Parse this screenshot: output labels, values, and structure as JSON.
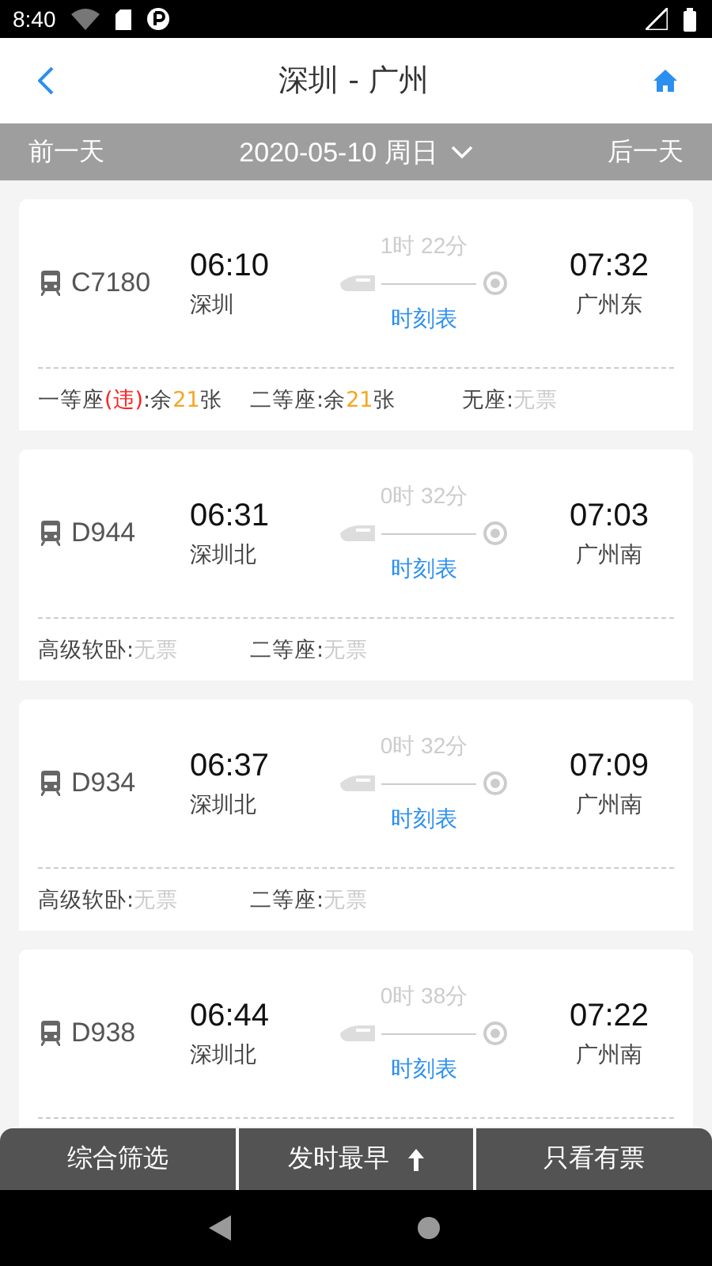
{
  "status_bar": {
    "time": "8:40"
  },
  "header": {
    "title": "深圳 - 广州"
  },
  "date_bar": {
    "prev": "前一天",
    "date": "2020-05-10 周日",
    "next": "后一天"
  },
  "trains": [
    {
      "number": "C7180",
      "depart_time": "06:10",
      "depart_station": "深圳",
      "duration": "1时 22分",
      "schedule_link": "时刻表",
      "arrive_time": "07:32",
      "arrive_station": "广州东",
      "seats": [
        [
          {
            "text": "一等座",
            "color": "#444444"
          },
          {
            "text": "(违)",
            "color": "#ff2222"
          },
          {
            "text": ":余",
            "color": "#444444"
          },
          {
            "text": "21",
            "color": "#f5a623"
          },
          {
            "text": "张",
            "color": "#444444"
          }
        ],
        [
          {
            "text": "二等座:余",
            "color": "#444444"
          },
          {
            "text": "21",
            "color": "#f5a623"
          },
          {
            "text": "张",
            "color": "#444444"
          }
        ],
        [
          {
            "text": "无座:",
            "color": "#444444"
          },
          {
            "text": "无票",
            "color": "#cccccc"
          }
        ]
      ]
    },
    {
      "number": "D944",
      "depart_time": "06:31",
      "depart_station": "深圳北",
      "duration": "0时 32分",
      "schedule_link": "时刻表",
      "arrive_time": "07:03",
      "arrive_station": "广州南",
      "seats": [
        [
          {
            "text": "高级软卧:",
            "color": "#444444"
          },
          {
            "text": "无票",
            "color": "#cccccc"
          }
        ],
        [
          {
            "text": "二等座:",
            "color": "#444444"
          },
          {
            "text": "无票",
            "color": "#cccccc"
          }
        ]
      ]
    },
    {
      "number": "D934",
      "depart_time": "06:37",
      "depart_station": "深圳北",
      "duration": "0时 32分",
      "schedule_link": "时刻表",
      "arrive_time": "07:09",
      "arrive_station": "广州南",
      "seats": [
        [
          {
            "text": "高级软卧:",
            "color": "#444444"
          },
          {
            "text": "无票",
            "color": "#cccccc"
          }
        ],
        [
          {
            "text": "二等座:",
            "color": "#444444"
          },
          {
            "text": "无票",
            "color": "#cccccc"
          }
        ]
      ]
    },
    {
      "number": "D938",
      "depart_time": "06:44",
      "depart_station": "深圳北",
      "duration": "0时 38分",
      "schedule_link": "时刻表",
      "arrive_time": "07:22",
      "arrive_station": "广州南"
    }
  ],
  "filter_bar": [
    {
      "label": "综合筛选",
      "kind": "plain"
    },
    {
      "label": "发时最早",
      "kind": "sort"
    },
    {
      "label": "只看有票",
      "kind": "plain"
    }
  ]
}
